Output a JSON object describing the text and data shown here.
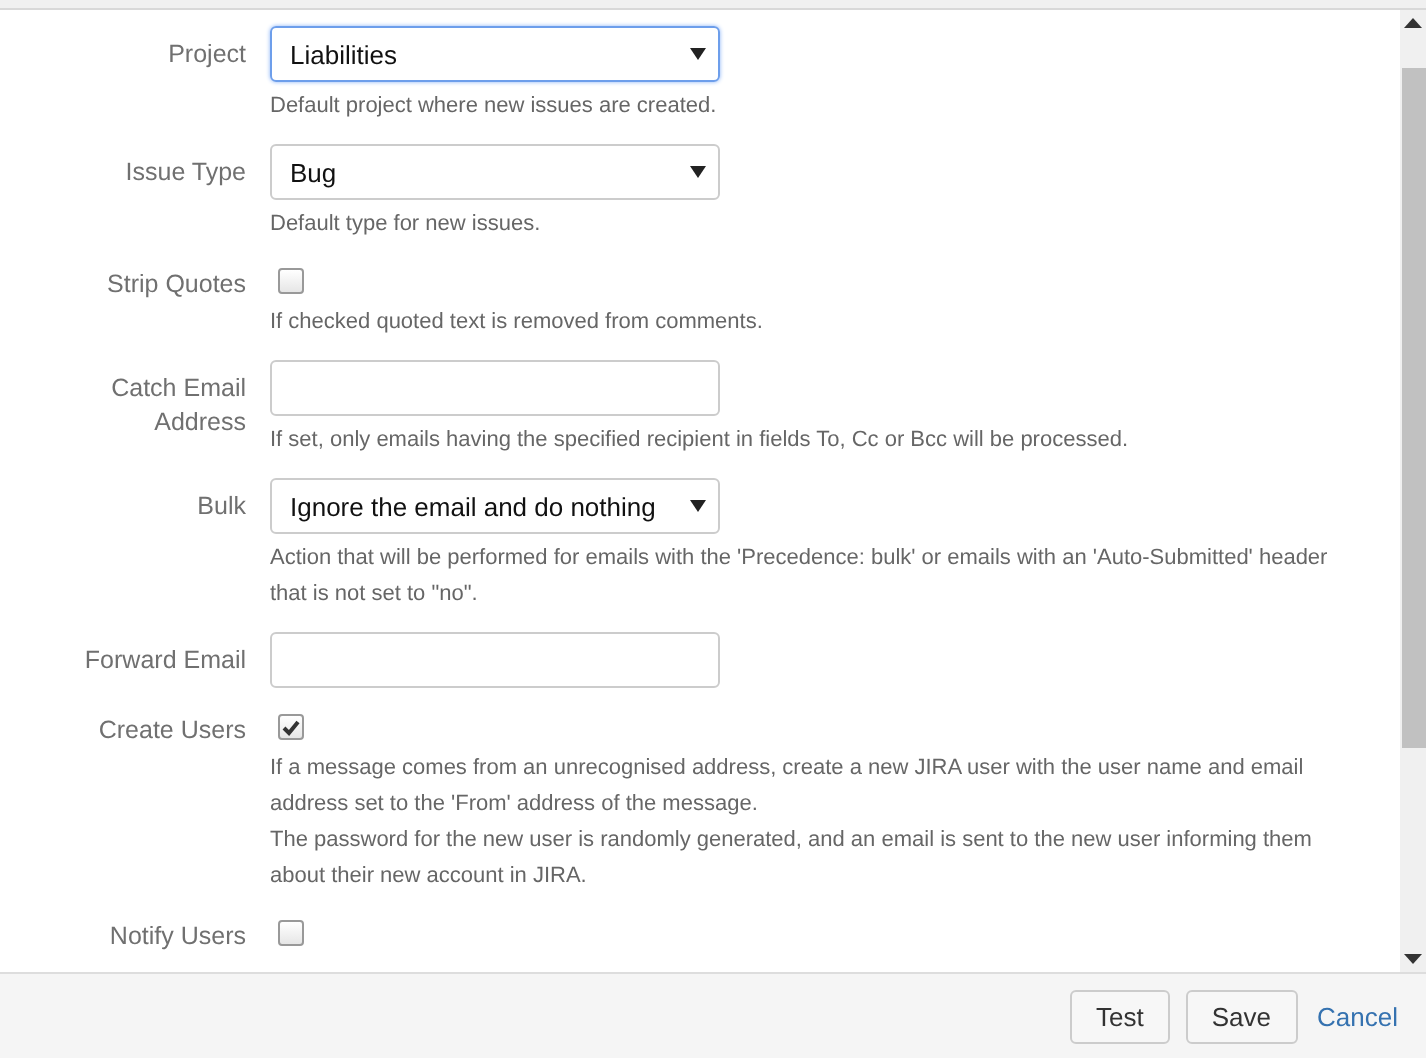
{
  "fields": [
    {
      "kind": "select",
      "label": "Project",
      "value": "Liabilities",
      "focused": true,
      "description": [
        "Default project where new issues are created."
      ]
    },
    {
      "kind": "select",
      "label": "Issue Type",
      "value": "Bug",
      "focused": false,
      "description": [
        "Default type for new issues."
      ]
    },
    {
      "kind": "checkbox",
      "label": "Strip Quotes",
      "checked": false,
      "description": [
        "If checked quoted text is removed from comments."
      ]
    },
    {
      "kind": "text",
      "label": "Catch Email Address",
      "description": [
        "If set, only emails having the specified recipient in fields To, Cc or Bcc will be processed."
      ]
    },
    {
      "kind": "select",
      "label": "Bulk",
      "value": "Ignore the email and do nothing",
      "focused": false,
      "description": [
        "Action that will be performed for emails with the 'Precedence: bulk' or emails with an 'Auto-Submitted' header that is not set to \"no\"."
      ]
    },
    {
      "kind": "text",
      "label": "Forward Email"
    },
    {
      "kind": "checkbox",
      "label": "Create Users",
      "checked": true,
      "description": [
        "If a message comes from an unrecognised address, create a new JIRA user with the user name and email address set to the 'From' address of the message.",
        "The password for the new user is randomly generated, and an email is sent to the new user informing them about their new account in JIRA."
      ]
    },
    {
      "kind": "checkbox",
      "label": "Notify Users",
      "checked": false
    }
  ],
  "footer": {
    "buttons": [
      "Test",
      "Save"
    ],
    "cancel": "Cancel"
  }
}
